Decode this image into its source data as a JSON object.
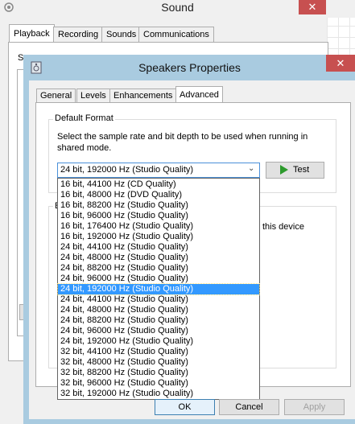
{
  "sound_window": {
    "title": "Sound",
    "close_glyph": "✕",
    "tabs": [
      "Playback",
      "Recording",
      "Sounds",
      "Communications"
    ],
    "panel_text_fragment": "Se"
  },
  "dialog": {
    "title": "Speakers Properties",
    "close_glyph": "✕",
    "tabs": [
      "General",
      "Levels",
      "Enhancements",
      "Advanced"
    ],
    "active_tab": "Advanced",
    "default_format": {
      "group_label": "Default Format",
      "description": "Select the sample rate and bit depth to be used when running in shared mode.",
      "selected_value": "24 bit, 192000 Hz (Studio Quality)",
      "test_label": "Test"
    },
    "exclusive_mode": {
      "label_fragment": "E",
      "text_fragment": "this device"
    },
    "buttons": {
      "ok": "OK",
      "cancel": "Cancel",
      "apply": "Apply"
    }
  },
  "dropdown_options": [
    "16 bit, 44100 Hz (CD Quality)",
    "16 bit, 48000 Hz (DVD Quality)",
    "16 bit, 88200 Hz (Studio Quality)",
    "16 bit, 96000 Hz (Studio Quality)",
    "16 bit, 176400 Hz (Studio Quality)",
    "16 bit, 192000 Hz (Studio Quality)",
    "24 bit, 44100 Hz (Studio Quality)",
    "24 bit, 48000 Hz (Studio Quality)",
    "24 bit, 88200 Hz (Studio Quality)",
    "24 bit, 96000 Hz (Studio Quality)",
    "24 bit, 192000 Hz (Studio Quality)",
    "24 bit, 44100 Hz (Studio Quality)",
    "24 bit, 48000 Hz (Studio Quality)",
    "24 bit, 88200 Hz (Studio Quality)",
    "24 bit, 96000 Hz (Studio Quality)",
    "24 bit, 192000 Hz (Studio Quality)",
    "32 bit, 44100 Hz (Studio Quality)",
    "32 bit, 48000 Hz (Studio Quality)",
    "32 bit, 88200 Hz (Studio Quality)",
    "32 bit, 96000 Hz (Studio Quality)",
    "32 bit, 192000 Hz (Studio Quality)"
  ],
  "highlighted_option_index": 10,
  "colors": {
    "titlebar": "#a9cbe0",
    "close_button": "#c75050",
    "selection": "#3399ff",
    "test_play_icon": "#2c9a2c"
  }
}
